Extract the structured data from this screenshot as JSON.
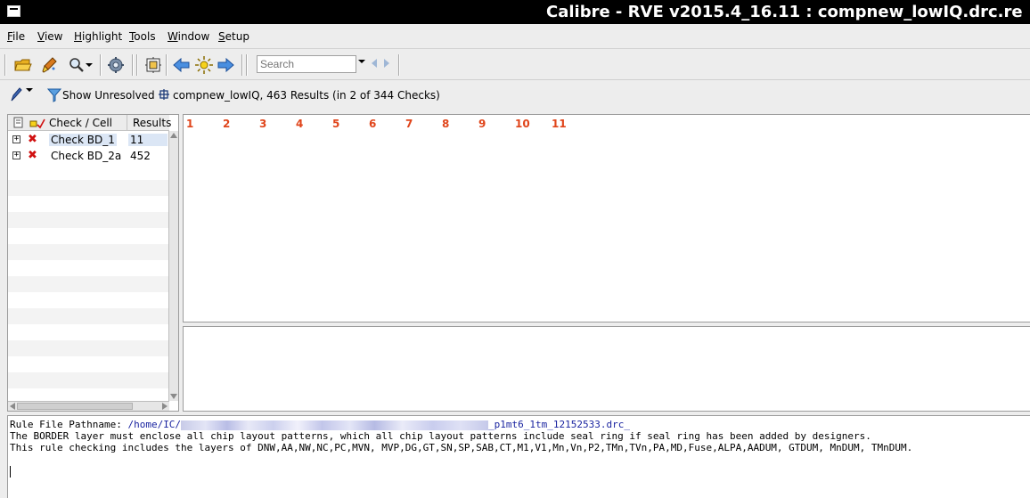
{
  "window": {
    "title": "Calibre - RVE v2015.4_16.11 : compnew_lowIQ.drc.re"
  },
  "menubar": {
    "items": [
      {
        "label": "File",
        "mnemonic": "F",
        "rest": "ile"
      },
      {
        "label": "View",
        "mnemonic": "V",
        "rest": "iew"
      },
      {
        "label": "Highlight",
        "mnemonic": "H",
        "rest": "ighlight"
      },
      {
        "label": "Tools",
        "mnemonic": "T",
        "rest": "ools"
      },
      {
        "label": "Window",
        "mnemonic": "W",
        "rest": "indow"
      },
      {
        "label": "Setup",
        "mnemonic": "S",
        "rest": "etup"
      }
    ]
  },
  "toolbar": {
    "icons": [
      "open-folder-icon",
      "highlight-brush-icon",
      "magnifier-icon",
      "settings-gear-icon",
      "layout-icon",
      "arrow-left-icon",
      "sun-icon",
      "arrow-right-icon"
    ],
    "search_placeholder": "Search"
  },
  "results_bar": {
    "show_unresolved": "Show Unresolved",
    "summary": "compnew_lowIQ, 463 Results (in 2 of 344 Checks)"
  },
  "tree": {
    "header": {
      "check_cell": "Check / Cell",
      "results": "Results"
    },
    "rows": [
      {
        "name": "Check BD_1",
        "count": "11",
        "selected": true
      },
      {
        "name": "Check BD_2a",
        "count": "452",
        "selected": false
      }
    ]
  },
  "results_table": {
    "columns": [
      "1",
      "2",
      "3",
      "4",
      "5",
      "6",
      "7",
      "8",
      "9",
      "10",
      "11"
    ],
    "column_color": "#e0451b"
  },
  "info": {
    "path_label": "Rule File Pathname: ",
    "path_prefix": "/home/IC/",
    "path_suffix": "_p1mt6_1tm_12152533.drc_",
    "line2": "The BORDER layer must enclose all chip layout patterns, which all chip layout patterns include seal ring if seal ring has been added by designers.",
    "line3": "This rule checking includes the layers of DNW,AA,NW,NC,PC,MVN, MVP,DG,GT,SN,SP,SAB,CT,M1,V1,Mn,Vn,P2,TMn,TVn,PA,MD,Fuse,ALPA,AADUM, GTDUM, MnDUM, TMnDUM."
  }
}
